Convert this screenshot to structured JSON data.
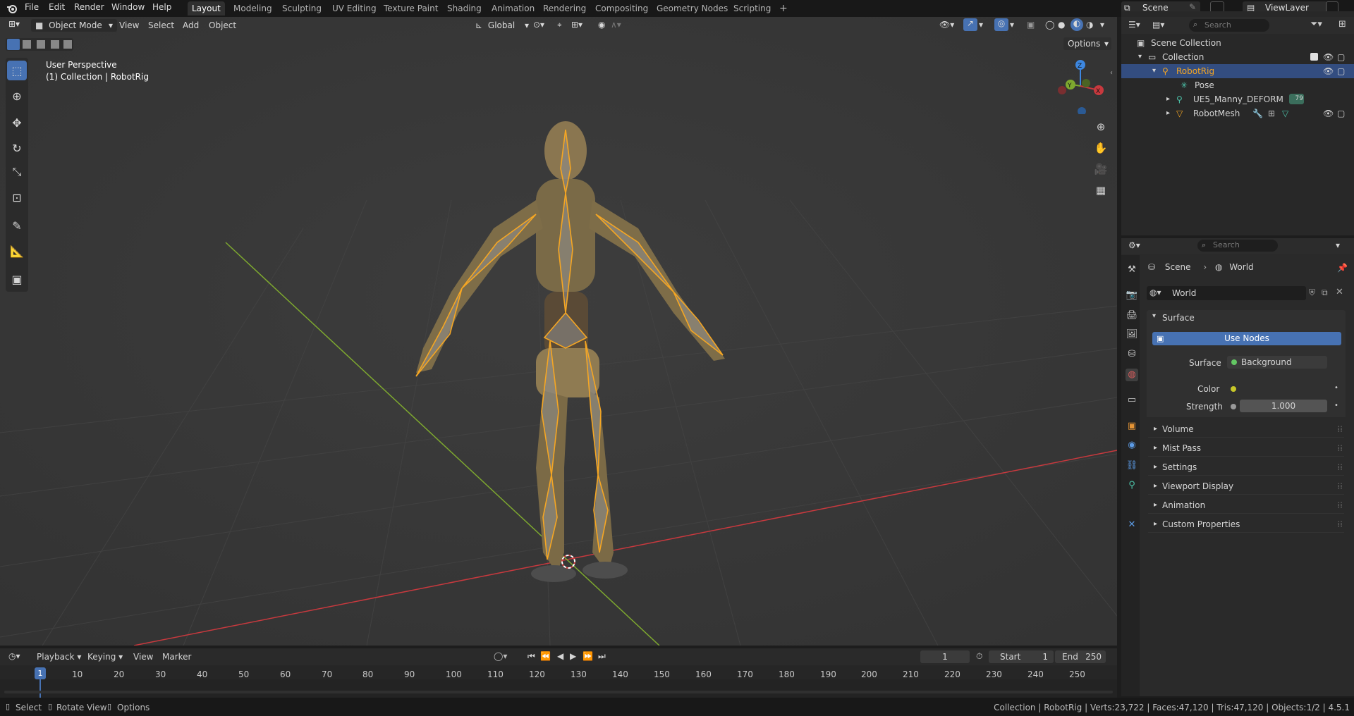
{
  "menubar": {
    "items": [
      "File",
      "Edit",
      "Render",
      "Window",
      "Help"
    ],
    "workspaces": [
      "Layout",
      "Modeling",
      "Sculpting",
      "UV Editing",
      "Texture Paint",
      "Shading",
      "Animation",
      "Rendering",
      "Compositing",
      "Geometry Nodes",
      "Scripting"
    ],
    "active_workspace": "Layout",
    "add_tab": "+",
    "scene_label": "Scene",
    "view_layer_label": "ViewLayer"
  },
  "viewport": {
    "mode": "Object Mode",
    "menus": [
      "View",
      "Select",
      "Add",
      "Object"
    ],
    "transform_orientation": "Global",
    "options": "Options",
    "overlay_title": "User Perspective",
    "overlay_subtitle": "(1) Collection | RobotRig",
    "gizmo_axes": {
      "z": "Z",
      "y": "Y",
      "x": "X"
    }
  },
  "outliner": {
    "search_placeholder": "Search",
    "rows": [
      {
        "label": "Scene Collection"
      },
      {
        "label": "Collection"
      },
      {
        "label": "RobotRig"
      },
      {
        "label": "Pose"
      },
      {
        "label": "UE5_Manny_DEFORM"
      },
      {
        "label": "RobotMesh"
      }
    ],
    "badge_count": "79"
  },
  "properties": {
    "search_placeholder": "Search",
    "breadcrumb": [
      "Scene",
      "World"
    ],
    "datablock_name": "World",
    "surface_panel": "Surface",
    "use_nodes": "Use Nodes",
    "surface_label": "Surface",
    "surface_value": "Background",
    "color_label": "Color",
    "strength_label": "Strength",
    "strength_value": "1.000",
    "collapsed_panels": [
      "Volume",
      "Mist Pass",
      "Settings",
      "Viewport Display",
      "Animation",
      "Custom Properties"
    ]
  },
  "timeline": {
    "menus": [
      "Playback",
      "Keying",
      "View",
      "Marker"
    ],
    "current_frame": "1",
    "start_label": "Start",
    "start_value": "1",
    "end_label": "End",
    "end_value": "250",
    "frame_markers": [
      "1",
      "10",
      "20",
      "30",
      "40",
      "50",
      "60",
      "70",
      "80",
      "90",
      "100",
      "110",
      "120",
      "130",
      "140",
      "150",
      "160",
      "170",
      "180",
      "190",
      "200",
      "210",
      "220",
      "230",
      "240",
      "250"
    ]
  },
  "statusbar": {
    "left": [
      "Select",
      "Rotate View",
      "Options"
    ],
    "right": "Collection | RobotRig | Verts:23,722 | Faces:47,120 | Tris:47,120 | Objects:1/2 | 4.5.1"
  },
  "colors": {
    "accent": "#4772b3",
    "selected_orange": "#f5a623",
    "axis_red": "#c8393e",
    "axis_green": "#7ea92f",
    "gizmo_blue": "#3d87e0"
  }
}
